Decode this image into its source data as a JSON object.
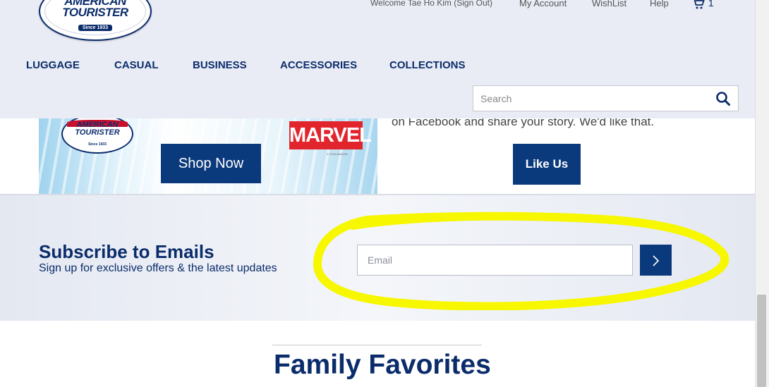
{
  "header": {
    "logo": {
      "brand_line1": "AMERICAN",
      "brand_line2": "TOURISTER",
      "since": "Since 1933"
    },
    "welcome": "Welcome Tae Ho Kim (Sign Out)",
    "my_account": "My Account",
    "wishlist": "WishList",
    "help": "Help",
    "cart_count": "1",
    "nav": [
      "LUGGAGE",
      "CASUAL",
      "BUSINESS",
      "ACCESSORIES",
      "COLLECTIONS"
    ],
    "search_placeholder": "Search"
  },
  "banner": {
    "mini_logo": {
      "brand_line1": "AMERICAN",
      "brand_line2": "TOURISTER",
      "since": "Since 1933"
    },
    "marvel": "MARVEL",
    "marvel_copy": "© 2016 MARVEL",
    "shop_now": "Shop Now",
    "facebook_text": "on Facebook and share your story. We'd like that.",
    "like_us": "Like Us"
  },
  "subscribe": {
    "title": "Subscribe to Emails",
    "subtitle": "Sign up for exclusive offers & the latest updates",
    "email_placeholder": "Email"
  },
  "section": {
    "title": "Family Favorites"
  },
  "colors": {
    "brand_navy": "#0b2c6b",
    "button_navy": "#0b3a7c",
    "highlight": "#f7f700",
    "marvel_red": "#e2252c"
  },
  "icons": [
    "search-icon",
    "cart-icon",
    "chevron-right-icon"
  ]
}
